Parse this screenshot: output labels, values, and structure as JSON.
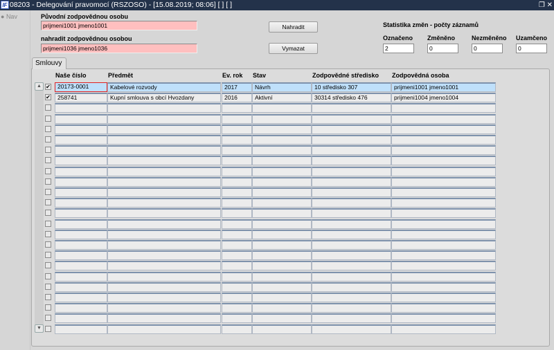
{
  "window": {
    "title": "08203 - Delegování pravomocí (RSZOSO) - [15.08.2019; 08:06]  [ ]  [ ]",
    "logo": "IF",
    "restore_icon": "restore-icon",
    "close_icon": "close-icon"
  },
  "nav": {
    "label": "Nav"
  },
  "form": {
    "original_label": "Původní zodpovědnou osobu",
    "original_value": "prijmeni1001 jmeno1001",
    "replace_label": "nahradit zodpovědnou osobou",
    "replace_value": "prijmeni1036 jmeno1036",
    "replace_button": "Nahradit",
    "clear_button": "Vymazat"
  },
  "stats": {
    "title": "Statistika změn - počty záznamů",
    "items": [
      {
        "label": "Označeno",
        "value": "2"
      },
      {
        "label": "Změněno",
        "value": "0"
      },
      {
        "label": "Nezměněno",
        "value": "0"
      },
      {
        "label": "Uzamčeno",
        "value": "0"
      }
    ]
  },
  "tabs": [
    {
      "label": "Smlouvy"
    }
  ],
  "table": {
    "columns": [
      "Naše číslo",
      "Předmět",
      "Ev. rok",
      "Stav",
      "Zodpovědné středisko",
      "Zodpovědná osoba"
    ],
    "rows": [
      {
        "checked": true,
        "cells": [
          "20173-0001",
          "Kabelové rozvody",
          "2017",
          "Návrh",
          "10 středisko 307",
          "prijmeni1001 jmeno1001"
        ]
      },
      {
        "checked": true,
        "cells": [
          "258741",
          "Kupní smlouva s obcí Hvozdany",
          "2016",
          "Aktivní",
          "30314 středisko 476",
          "prijmeni1004 jmeno1004"
        ]
      }
    ],
    "total_rows": 24
  }
}
